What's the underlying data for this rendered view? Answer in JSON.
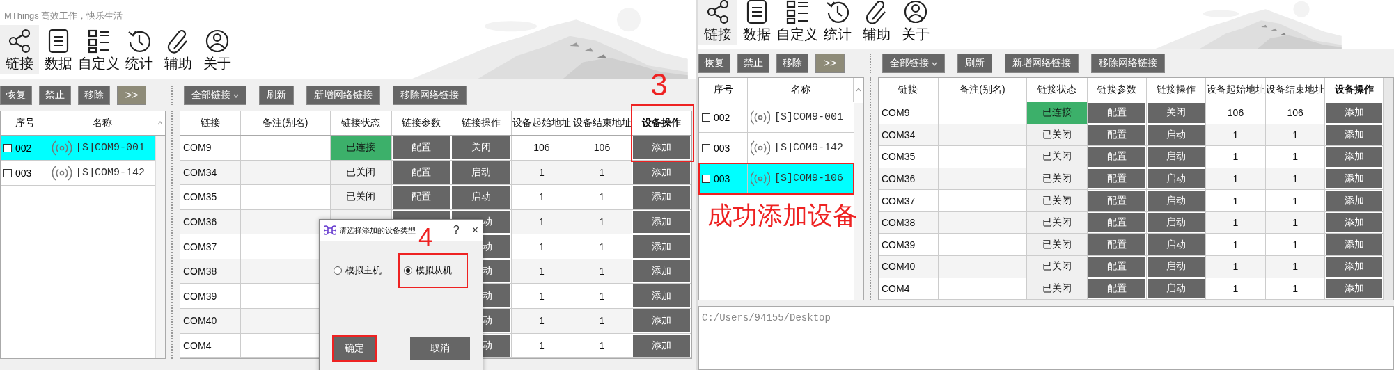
{
  "screens": [
    {
      "app_title": "MThings  高效工作，快乐生活",
      "nav": [
        {
          "label": "链接",
          "selected": true
        },
        {
          "label": "数据",
          "selected": false
        },
        {
          "label": "自定义",
          "selected": false
        },
        {
          "label": "统计",
          "selected": false
        },
        {
          "label": "辅助",
          "selected": false
        },
        {
          "label": "关于",
          "selected": false
        }
      ],
      "list_buttons": [
        {
          "label": "恢复",
          "kind": "action"
        },
        {
          "label": "禁止",
          "kind": "action"
        },
        {
          "label": "移除",
          "kind": "action"
        },
        {
          "label": ">>",
          "kind": "expand"
        }
      ],
      "list": {
        "columns": [
          "序号",
          "名称"
        ],
        "rows": [
          {
            "checked": false,
            "number": "002",
            "name": "[S]COM9-001",
            "selected": true,
            "highlighted": false
          },
          {
            "checked": false,
            "number": "003",
            "name": "[S]COM9-142",
            "selected": false,
            "highlighted": false
          }
        ]
      },
      "table_buttons": [
        {
          "label": "全部链接",
          "kind": "dropdown"
        },
        {
          "label": "刷新",
          "kind": "action"
        },
        {
          "label": "新增网络链接",
          "kind": "action"
        },
        {
          "label": "移除网络链接",
          "kind": "action"
        }
      ],
      "table": {
        "columns": [
          {
            "label": "链接",
            "emphasized": false
          },
          {
            "label": "备注(别名)",
            "emphasized": false
          },
          {
            "label": "链接状态",
            "emphasized": false
          },
          {
            "label": "链接参数",
            "emphasized": false
          },
          {
            "label": "链接操作",
            "emphasized": false
          },
          {
            "label": "设备起始地址",
            "emphasized": false
          },
          {
            "label": "设备结束地址",
            "emphasized": false
          },
          {
            "label": "设备操作",
            "emphasized": true,
            "highlighted": true,
            "callout": "3"
          }
        ],
        "rows": [
          {
            "link": "COM9",
            "status": "已连接",
            "connected": true,
            "param": "配置",
            "op": "关闭",
            "start": "106",
            "end": "106",
            "device_op": "添加"
          },
          {
            "link": "COM34",
            "status": "已关闭",
            "connected": false,
            "param": "配置",
            "op": "启动",
            "start": "1",
            "end": "1",
            "device_op": "添加"
          },
          {
            "link": "COM35",
            "status": "已关闭",
            "connected": false,
            "param": "配置",
            "op": "启动",
            "start": "1",
            "end": "1",
            "device_op": "添加"
          },
          {
            "link": "COM36",
            "covered": true,
            "op": "动",
            "start": "1",
            "end": "1",
            "device_op": "添加"
          },
          {
            "link": "COM37",
            "covered": true,
            "op": "动",
            "start": "1",
            "end": "1",
            "device_op": "添加"
          },
          {
            "link": "COM38",
            "covered": true,
            "op": "动",
            "start": "1",
            "end": "1",
            "device_op": "添加"
          },
          {
            "link": "COM39",
            "covered": true,
            "op": "动",
            "start": "1",
            "end": "1",
            "device_op": "添加"
          },
          {
            "link": "COM40",
            "covered": true,
            "op": "动",
            "start": "1",
            "end": "1",
            "device_op": "添加"
          },
          {
            "link": "COM4",
            "covered": true,
            "op": "动",
            "start": "1",
            "end": "1",
            "device_op": "添加"
          }
        ]
      },
      "dialog": {
        "title": "请选择添加的设备类型",
        "callout": "4",
        "help": "?",
        "close": "×",
        "options": [
          {
            "label": "模拟主机",
            "selected": false,
            "highlighted": false
          },
          {
            "label": "模拟从机",
            "selected": true,
            "highlighted": true
          }
        ],
        "buttons": [
          {
            "label": "确定",
            "highlighted": true
          },
          {
            "label": "取消",
            "highlighted": false
          }
        ]
      }
    },
    {
      "nav": [
        {
          "label": "链接",
          "selected": true
        },
        {
          "label": "数据",
          "selected": false
        },
        {
          "label": "自定义",
          "selected": false
        },
        {
          "label": "统计",
          "selected": false
        },
        {
          "label": "辅助",
          "selected": false
        },
        {
          "label": "关于",
          "selected": false
        }
      ],
      "list_buttons": [
        {
          "label": "恢复",
          "kind": "action"
        },
        {
          "label": "禁止",
          "kind": "action"
        },
        {
          "label": "移除",
          "kind": "action"
        },
        {
          "label": ">>",
          "kind": "expand"
        }
      ],
      "list": {
        "columns": [
          "序号",
          "名称"
        ],
        "rows": [
          {
            "checked": false,
            "number": "002",
            "name": "[S]COM9-001",
            "selected": false,
            "highlighted": false
          },
          {
            "checked": false,
            "number": "003",
            "name": "[S]COM9-142",
            "selected": false,
            "highlighted": false
          },
          {
            "checked": false,
            "number": "003",
            "name": "[S]COM9-106",
            "selected": true,
            "highlighted": true
          }
        ],
        "callout": "成功添加设备"
      },
      "table_buttons": [
        {
          "label": "全部链接",
          "kind": "dropdown"
        },
        {
          "label": "刷新",
          "kind": "action"
        },
        {
          "label": "新增网络链接",
          "kind": "action"
        },
        {
          "label": "移除网络链接",
          "kind": "action"
        }
      ],
      "table": {
        "columns": [
          {
            "label": "链接",
            "emphasized": false
          },
          {
            "label": "备注(别名)",
            "emphasized": false
          },
          {
            "label": "链接状态",
            "emphasized": false
          },
          {
            "label": "链接参数",
            "emphasized": false
          },
          {
            "label": "链接操作",
            "emphasized": false
          },
          {
            "label": "设备起始地址",
            "emphasized": false
          },
          {
            "label": "设备结束地址",
            "emphasized": false
          },
          {
            "label": "设备操作",
            "emphasized": true,
            "highlighted": false
          }
        ],
        "rows": [
          {
            "link": "COM9",
            "status": "已连接",
            "connected": true,
            "param": "配置",
            "op": "关闭",
            "start": "106",
            "end": "106",
            "device_op": "添加"
          },
          {
            "link": "COM34",
            "status": "已关闭",
            "connected": false,
            "param": "配置",
            "op": "启动",
            "start": "1",
            "end": "1",
            "device_op": "添加"
          },
          {
            "link": "COM35",
            "status": "已关闭",
            "connected": false,
            "param": "配置",
            "op": "启动",
            "start": "1",
            "end": "1",
            "device_op": "添加"
          },
          {
            "link": "COM36",
            "status": "已关闭",
            "connected": false,
            "param": "配置",
            "op": "启动",
            "start": "1",
            "end": "1",
            "device_op": "添加"
          },
          {
            "link": "COM37",
            "status": "已关闭",
            "connected": false,
            "param": "配置",
            "op": "启动",
            "start": "1",
            "end": "1",
            "device_op": "添加"
          },
          {
            "link": "COM38",
            "status": "已关闭",
            "connected": false,
            "param": "配置",
            "op": "启动",
            "start": "1",
            "end": "1",
            "device_op": "添加"
          },
          {
            "link": "COM39",
            "status": "已关闭",
            "connected": false,
            "param": "配置",
            "op": "启动",
            "start": "1",
            "end": "1",
            "device_op": "添加"
          },
          {
            "link": "COM40",
            "status": "已关闭",
            "connected": false,
            "param": "配置",
            "op": "启动",
            "start": "1",
            "end": "1",
            "device_op": "添加"
          },
          {
            "link": "COM4",
            "status": "已关闭",
            "connected": false,
            "param": "配置",
            "op": "启动",
            "start": "1",
            "end": "1",
            "device_op": "添加"
          }
        ]
      },
      "log": "C:/Users/94155/Desktop"
    }
  ]
}
